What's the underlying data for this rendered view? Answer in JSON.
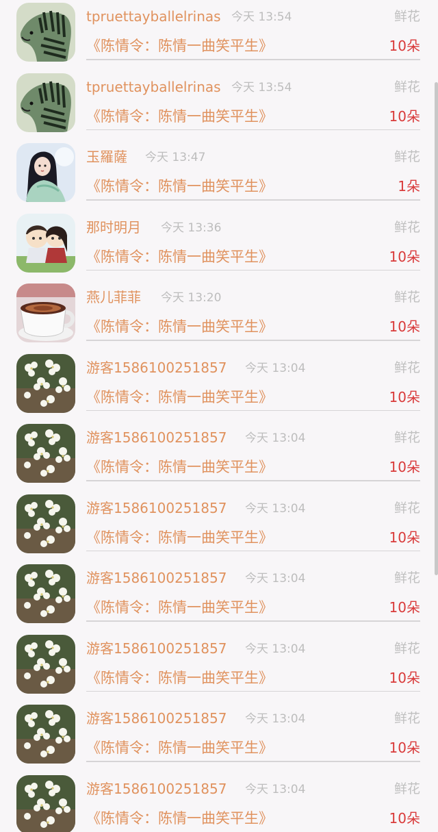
{
  "list": {
    "items": [
      {
        "avatar": "zebra-avatar",
        "username": "tpruettayballelrinas",
        "time": "今天 13:54",
        "gift_type": "鲜花",
        "work_title": "《陈情令：陈情一曲笑平生》",
        "count": "10朵"
      },
      {
        "avatar": "zebra-avatar",
        "username": "tpruettayballelrinas",
        "time": "今天 13:54",
        "gift_type": "鲜花",
        "work_title": "《陈情令：陈情一曲笑平生》",
        "count": "10朵"
      },
      {
        "avatar": "fairy-avatar",
        "username": "玉羅薩",
        "time": "今天 13:47",
        "gift_type": "鲜花",
        "work_title": "《陈情令：陈情一曲笑平生》",
        "count": "1朵"
      },
      {
        "avatar": "chibi-avatar",
        "username": "那时明月",
        "time": "今天 13:36",
        "gift_type": "鲜花",
        "work_title": "《陈情令：陈情一曲笑平生》",
        "count": "10朵"
      },
      {
        "avatar": "coffee-avatar",
        "username": "燕儿菲菲",
        "time": "今天 13:20",
        "gift_type": "鲜花",
        "work_title": "《陈情令：陈情一曲笑平生》",
        "count": "10朵"
      },
      {
        "avatar": "flowers-avatar",
        "username": "游客1586100251857",
        "time": "今天 13:04",
        "gift_type": "鲜花",
        "work_title": "《陈情令：陈情一曲笑平生》",
        "count": "10朵"
      },
      {
        "avatar": "flowers-avatar",
        "username": "游客1586100251857",
        "time": "今天 13:04",
        "gift_type": "鲜花",
        "work_title": "《陈情令：陈情一曲笑平生》",
        "count": "10朵"
      },
      {
        "avatar": "flowers-avatar",
        "username": "游客1586100251857",
        "time": "今天 13:04",
        "gift_type": "鲜花",
        "work_title": "《陈情令：陈情一曲笑平生》",
        "count": "10朵"
      },
      {
        "avatar": "flowers-avatar",
        "username": "游客1586100251857",
        "time": "今天 13:04",
        "gift_type": "鲜花",
        "work_title": "《陈情令：陈情一曲笑平生》",
        "count": "10朵"
      },
      {
        "avatar": "flowers-avatar",
        "username": "游客1586100251857",
        "time": "今天 13:04",
        "gift_type": "鲜花",
        "work_title": "《陈情令：陈情一曲笑平生》",
        "count": "10朵"
      },
      {
        "avatar": "flowers-avatar",
        "username": "游客1586100251857",
        "time": "今天 13:04",
        "gift_type": "鲜花",
        "work_title": "《陈情令：陈情一曲笑平生》",
        "count": "10朵"
      },
      {
        "avatar": "flowers-avatar",
        "username": "游客1586100251857",
        "time": "今天 13:04",
        "gift_type": "鲜花",
        "work_title": "《陈情令：陈情一曲笑平生》",
        "count": "10朵"
      }
    ]
  },
  "colors": {
    "username": "#e0925e",
    "title": "#e0925e",
    "count": "#d93a3a",
    "muted": "#bdbdbd",
    "background": "#f8f6f8"
  }
}
